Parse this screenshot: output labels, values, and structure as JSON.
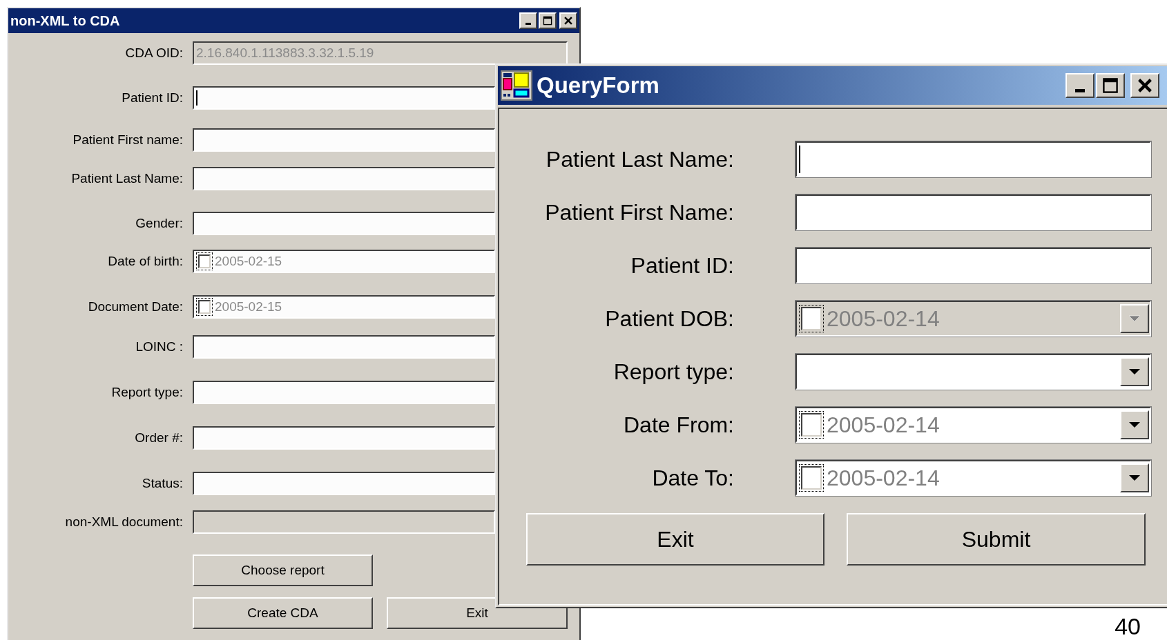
{
  "windows": [
    {
      "title": "non-XML to CDA",
      "fields": [
        {
          "label": "CDA OID:",
          "kind": "text",
          "value": "2.16.840.1.113883.3.32.1.5.19",
          "disabled": true
        },
        {
          "label": "Patient ID:",
          "kind": "text",
          "disabled": false,
          "focused": true
        },
        {
          "label": "Patient First name:",
          "kind": "text",
          "disabled": false
        },
        {
          "label": "Patient Last Name:",
          "kind": "text",
          "disabled": false
        },
        {
          "label": "Gender:",
          "kind": "text",
          "disabled": false
        },
        {
          "label": "Date of birth:",
          "kind": "date",
          "value": "2005-02-15",
          "checked": false
        },
        {
          "label": "Document Date:",
          "kind": "date",
          "value": "2005-02-15",
          "checked": false
        },
        {
          "label": "LOINC :",
          "kind": "text",
          "disabled": false
        },
        {
          "label": "Report type:",
          "kind": "text",
          "disabled": false
        },
        {
          "label": "Order #:",
          "kind": "text",
          "disabled": false
        },
        {
          "label": "Status:",
          "kind": "text",
          "disabled": false
        },
        {
          "label": "non-XML document:",
          "kind": "text",
          "disabled": true
        }
      ],
      "buttons": [
        "Choose report",
        "Create CDA",
        "Exit"
      ]
    },
    {
      "title": "QueryForm",
      "fields": [
        {
          "label": "Patient Last Name:",
          "kind": "text",
          "disabled": false,
          "focused": true
        },
        {
          "label": "Patient First Name:",
          "kind": "text",
          "disabled": false
        },
        {
          "label": "Patient ID:",
          "kind": "text",
          "disabled": false
        },
        {
          "label": "Patient DOB:",
          "kind": "date_combo",
          "value": "2005-02-14",
          "checked": false,
          "disabled": true
        },
        {
          "label": "Report type:",
          "kind": "combo",
          "disabled": false
        },
        {
          "label": "Date From:",
          "kind": "date_combo",
          "value": "2005-02-14",
          "checked": false,
          "disabled": false
        },
        {
          "label": "Date To:",
          "kind": "date_combo",
          "value": "2005-02-14",
          "checked": false,
          "disabled": false
        }
      ],
      "buttons": [
        "Exit",
        "Submit"
      ]
    }
  ],
  "page_number": "40"
}
